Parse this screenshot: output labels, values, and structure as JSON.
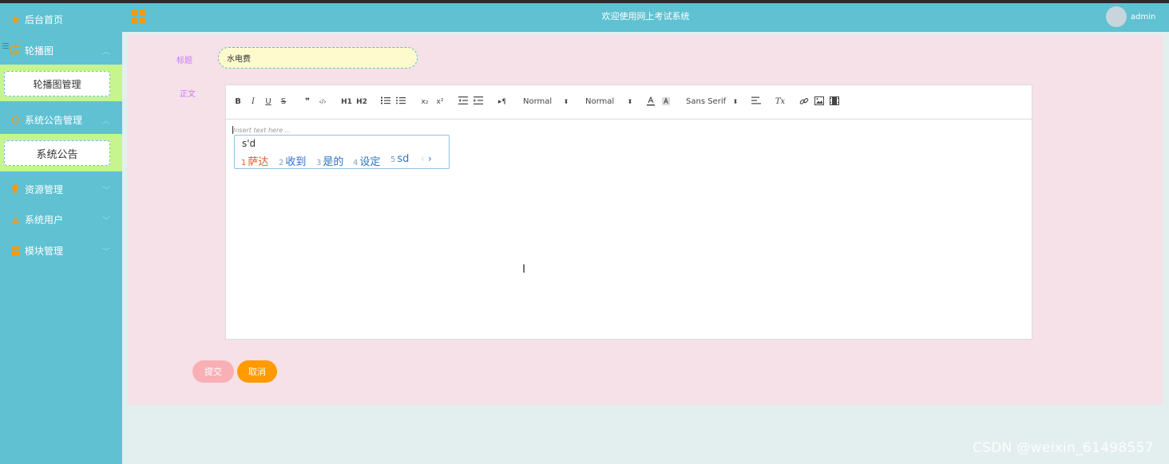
{
  "sidebar": {
    "items": [
      {
        "label": "后台首页",
        "icon": "home-icon"
      },
      {
        "label": "轮播图",
        "icon": "image-icon",
        "submenu": [
          "轮播图管理"
        ]
      },
      {
        "label": "系统公告管理",
        "icon": "info-icon",
        "submenu": [
          "系统公告"
        ]
      },
      {
        "label": "资源管理",
        "icon": "lightbulb-icon"
      },
      {
        "label": "系统用户",
        "icon": "user-icon"
      },
      {
        "label": "模块管理",
        "icon": "grid-icon"
      }
    ]
  },
  "header": {
    "title": "欢迎使用网上考试系统",
    "username": "admin"
  },
  "form": {
    "title_label": "标题",
    "title_value": "水电费",
    "content_label": "正文",
    "submit_label": "提交",
    "cancel_label": "取消"
  },
  "editor": {
    "placeholder": "Insert text here ...",
    "toolbar": {
      "bold": "B",
      "italic": "I",
      "underline": "U",
      "strike": "S",
      "blockquote": "❞",
      "code": "‹/›",
      "h1": "H1",
      "h2": "H2",
      "subscript": "x₂",
      "superscript": "x²",
      "direction": "▸¶",
      "size_select": "Normal",
      "header_select": "Normal",
      "font_select": "Sans Serif",
      "clean": "Tx"
    }
  },
  "ime": {
    "input": "s'd",
    "candidates": [
      {
        "n": "1",
        "text": "萨达"
      },
      {
        "n": "2",
        "text": "收到"
      },
      {
        "n": "3",
        "text": "是的"
      },
      {
        "n": "4",
        "text": "设定"
      },
      {
        "n": "5",
        "text": "sd"
      }
    ],
    "prev": "‹",
    "next": "›"
  },
  "watermark": "CSDN @weixin_61498557",
  "colors": {
    "sidebar": "#5fc1d2",
    "submenu_bg": "#c6f58e",
    "panel_bg": "#f5e1e7",
    "submit": "#f8b0b5",
    "cancel": "#ff9a00",
    "label": "#c879ff"
  }
}
